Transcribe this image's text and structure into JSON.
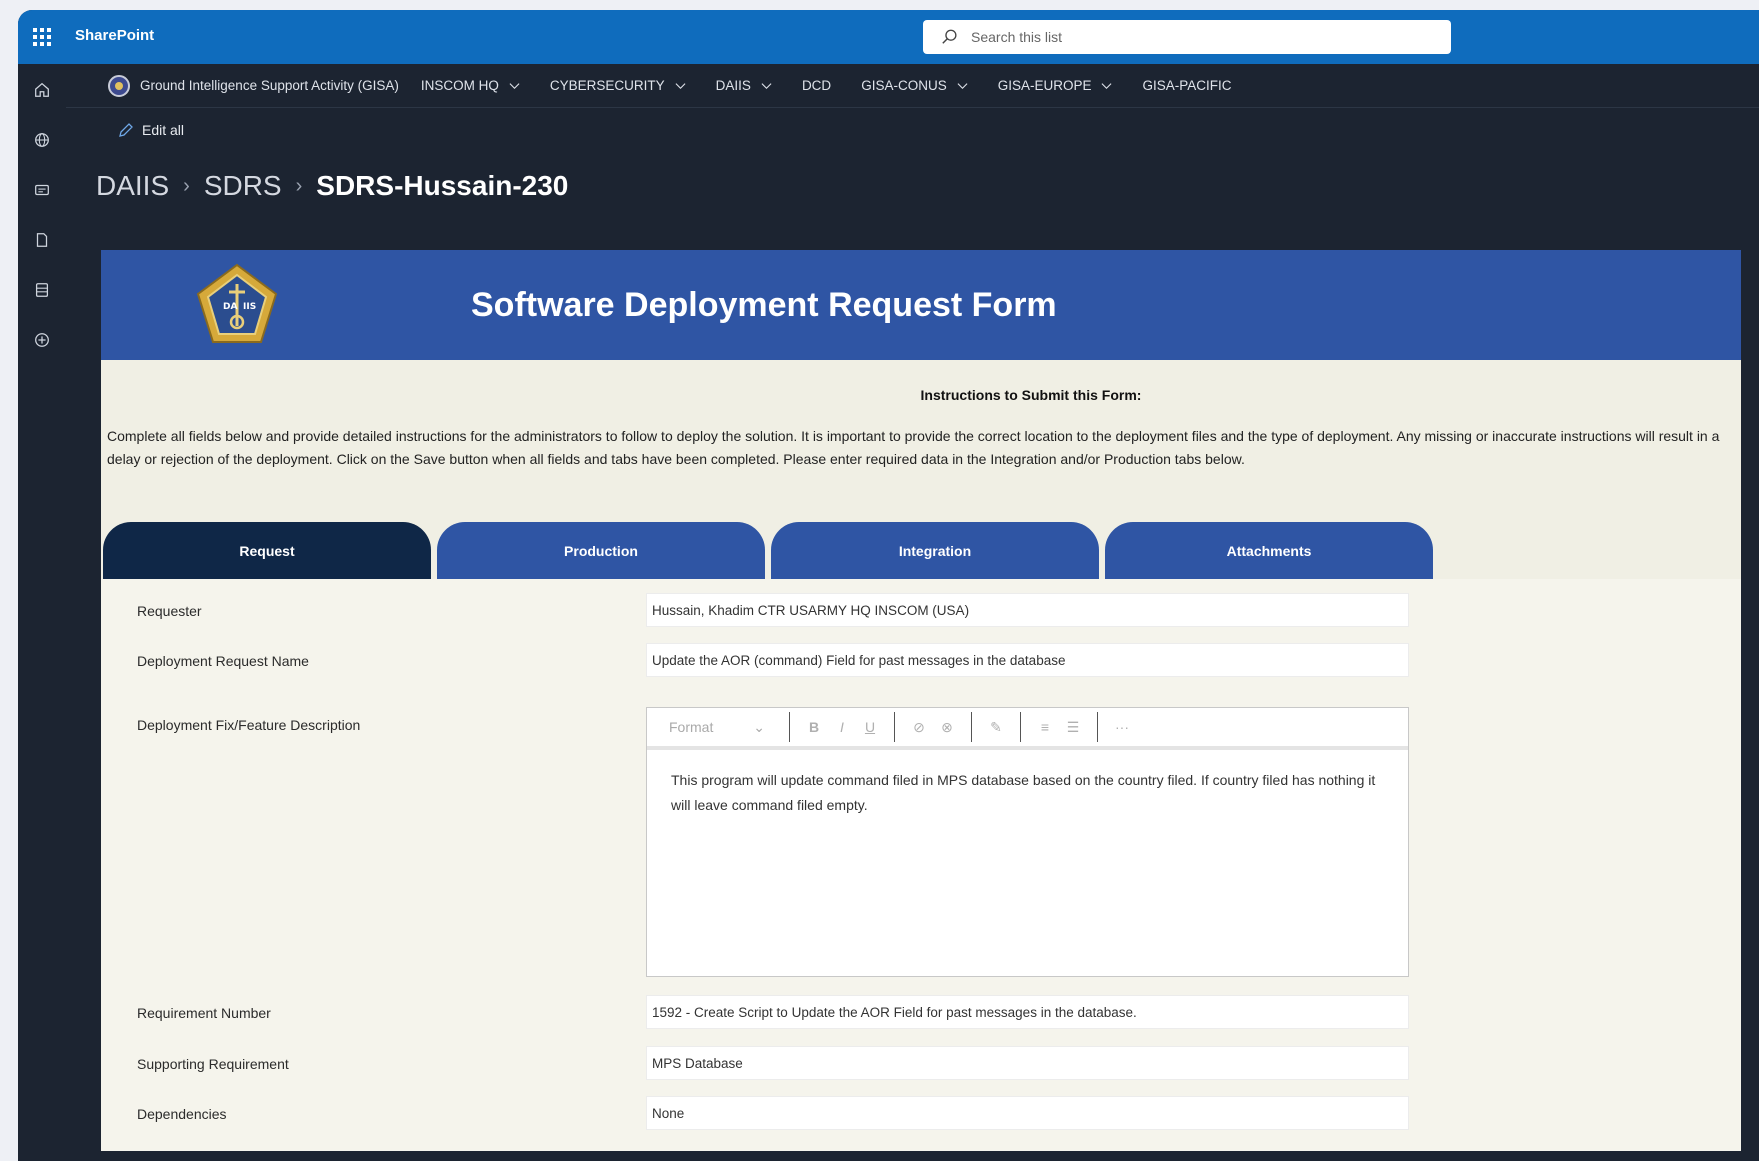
{
  "suite": {
    "app_name": "SharePoint",
    "search_placeholder": "Search this list"
  },
  "hub": {
    "title": "Ground Intelligence Support Activity (GISA)",
    "items": [
      {
        "label": "INSCOM HQ",
        "dropdown": true
      },
      {
        "label": "CYBERSECURITY",
        "dropdown": true
      },
      {
        "label": "DAIIS",
        "dropdown": true
      },
      {
        "label": "DCD",
        "dropdown": false
      },
      {
        "label": "GISA-CONUS",
        "dropdown": true
      },
      {
        "label": "GISA-EUROPE",
        "dropdown": true
      },
      {
        "label": "GISA-PACIFIC",
        "dropdown": false
      }
    ]
  },
  "rail": {
    "icons": [
      "home-icon",
      "globe-icon",
      "news-icon",
      "file-icon",
      "list-icon",
      "add-icon"
    ]
  },
  "command": {
    "edit_all": "Edit all"
  },
  "breadcrumb": {
    "level1": "DAIIS",
    "level2": "SDRS",
    "current": "SDRS-Hussain-230"
  },
  "form": {
    "title": "Software Deployment Request Form",
    "seal_text": "DA IIS",
    "instructions_heading": "Instructions to Submit this Form:",
    "instructions_text": "Complete all fields below and provide detailed instructions for the administrators to follow to deploy the solution. It is important to provide the correct location to the deployment files and the type of deployment. Any missing or inaccurate instructions will result in a delay or rejection of the deployment.  Click on the Save button when all fields and tabs have been completed. Please enter required data in the Integration and/or Production tabs below.",
    "tabs": [
      {
        "label": "Request",
        "active": true
      },
      {
        "label": "Production",
        "active": false
      },
      {
        "label": "Integration",
        "active": false
      },
      {
        "label": "Attachments",
        "active": false
      }
    ],
    "fields": {
      "requester": {
        "label": "Requester",
        "value": "Hussain, Khadim CTR USARMY HQ INSCOM (USA)"
      },
      "request_name": {
        "label": "Deployment Request Name",
        "value": "Update the AOR (command) Field for past messages in the database"
      },
      "description": {
        "label": "Deployment Fix/Feature Description",
        "format_label": "Format",
        "value": "This program will update command filed in MPS database based on the country filed. If country filed has nothing it will leave command filed empty."
      },
      "requirement_number": {
        "label": "Requirement Number",
        "value": "1592 - Create Script to Update the AOR Field for past messages in the database."
      },
      "supporting_requirement": {
        "label": "Supporting Requirement",
        "value": "MPS Database"
      },
      "dependencies": {
        "label": "Dependencies",
        "value": "None"
      }
    }
  },
  "colors": {
    "suite_blue": "#0f6cbd",
    "dark_bg": "#1c2431",
    "banner_blue": "#2f55a4",
    "active_tab": "#0f2747",
    "form_bg": "#f0efe4"
  }
}
